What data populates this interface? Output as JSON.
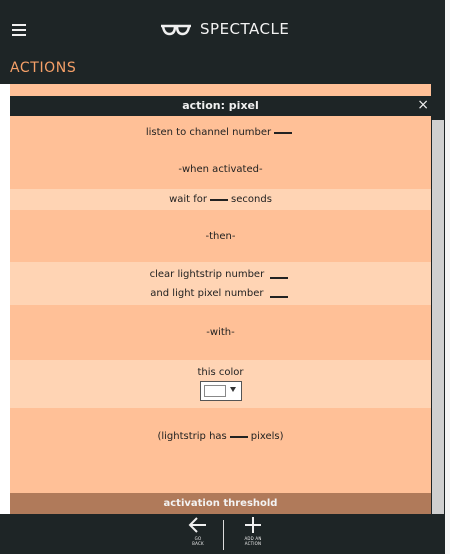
{
  "header": {
    "menu_icon": "hamburger-icon",
    "logo_icon": "glasses-icon",
    "brand": "SPECTACLE"
  },
  "section": {
    "title": "ACTIONS"
  },
  "panel": {
    "title": "action: pixel",
    "close": "×",
    "rows": {
      "listen": "listen to channel number",
      "when": "-when activated-",
      "wait_prefix": "wait for",
      "wait_suffix": "seconds",
      "then": "-then-",
      "clear": "clear lightstrip number",
      "light": "and light pixel number",
      "with": "-with-",
      "this_color": "this color",
      "has_prefix": "(lightstrip has",
      "has_suffix": "pixels)"
    },
    "color_value": "#ffffff",
    "threshold": "activation threshold"
  },
  "footer": {
    "go_back_icon": "arrow-left-icon",
    "go_back": "GO\nBACK",
    "add_icon": "plus-icon",
    "add_action": "ADD AN\nACTION"
  },
  "colors": {
    "dark_bar": "#1e2526",
    "accent": "#f6a068",
    "row_dark": "#ffc097",
    "row_light": "#ffd4b4",
    "threshold_bar": "#b07a5a"
  }
}
